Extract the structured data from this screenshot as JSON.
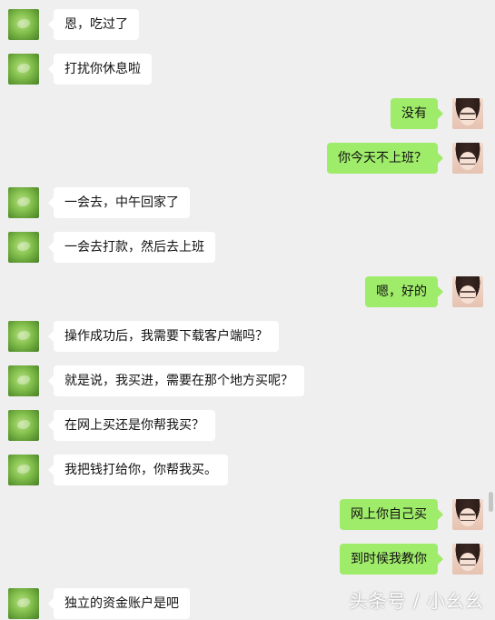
{
  "messages": [
    {
      "side": "in",
      "text": "恩，吃过了"
    },
    {
      "side": "in",
      "text": "打扰你休息啦"
    },
    {
      "side": "out",
      "text": "没有"
    },
    {
      "side": "out",
      "text": "你今天不上班？"
    },
    {
      "side": "in",
      "text": "一会去，中午回家了"
    },
    {
      "side": "in",
      "text": "一会去打款，然后去上班"
    },
    {
      "side": "out",
      "text": "嗯，好的"
    },
    {
      "side": "in",
      "text": "操作成功后，我需要下载客户端吗？"
    },
    {
      "side": "in",
      "text": "就是说，我买进，需要在那个地方买呢？"
    },
    {
      "side": "in",
      "text": "在网上买还是你帮我买？"
    },
    {
      "side": "in",
      "text": "我把钱打给你，你帮我买。"
    },
    {
      "side": "out",
      "text": "网上你自己买"
    },
    {
      "side": "out",
      "text": "到时候我教你"
    },
    {
      "side": "in",
      "text": "独立的资金账户是吧"
    }
  ],
  "watermark": "头条号 / 小幺幺",
  "colors": {
    "background": "#efefef",
    "incoming_bubble": "#ffffff",
    "outgoing_bubble": "#9feb6a"
  },
  "icons": {
    "contact_avatar": "contact-avatar-icon",
    "self_avatar": "self-avatar-icon"
  }
}
